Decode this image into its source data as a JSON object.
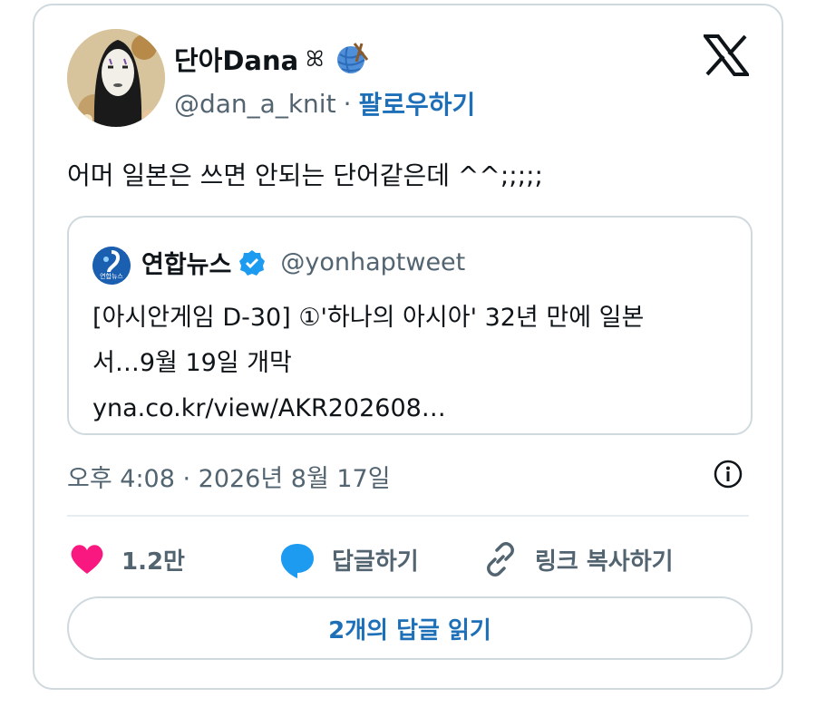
{
  "author": {
    "name": "단아Dana",
    "name_symbol": "ꕤ",
    "handle": "@dan_a_knit",
    "separator": "·",
    "follow_label": "팔로우하기"
  },
  "tweet": {
    "text": "어머 일본은 쓰면 안되는 단어같은데 ^^;;;;;"
  },
  "quote": {
    "name": "연합뉴스",
    "handle": "@yonhaptweet",
    "logo_text": "연합뉴스",
    "lines": [
      "[아시안게임 D-30] ①'하나의 아시아' 32년 만에 일본",
      "서…9월 19일 개막",
      "yna.co.kr/view/AKR202608…"
    ]
  },
  "timestamp": "오후 4:08 · 2026년 8월 17일",
  "actions": {
    "likes": "1.2만",
    "reply_label": "답글하기",
    "copy_link_label": "링크 복사하기"
  },
  "replies_button_label": "2개의 답글 읽기",
  "colors": {
    "accent": "#1d6fb8",
    "heart": "#f91880",
    "reply": "#1d9bf0",
    "verified": "#1d9bf0",
    "border": "#cfd9de",
    "muted": "#536471"
  }
}
